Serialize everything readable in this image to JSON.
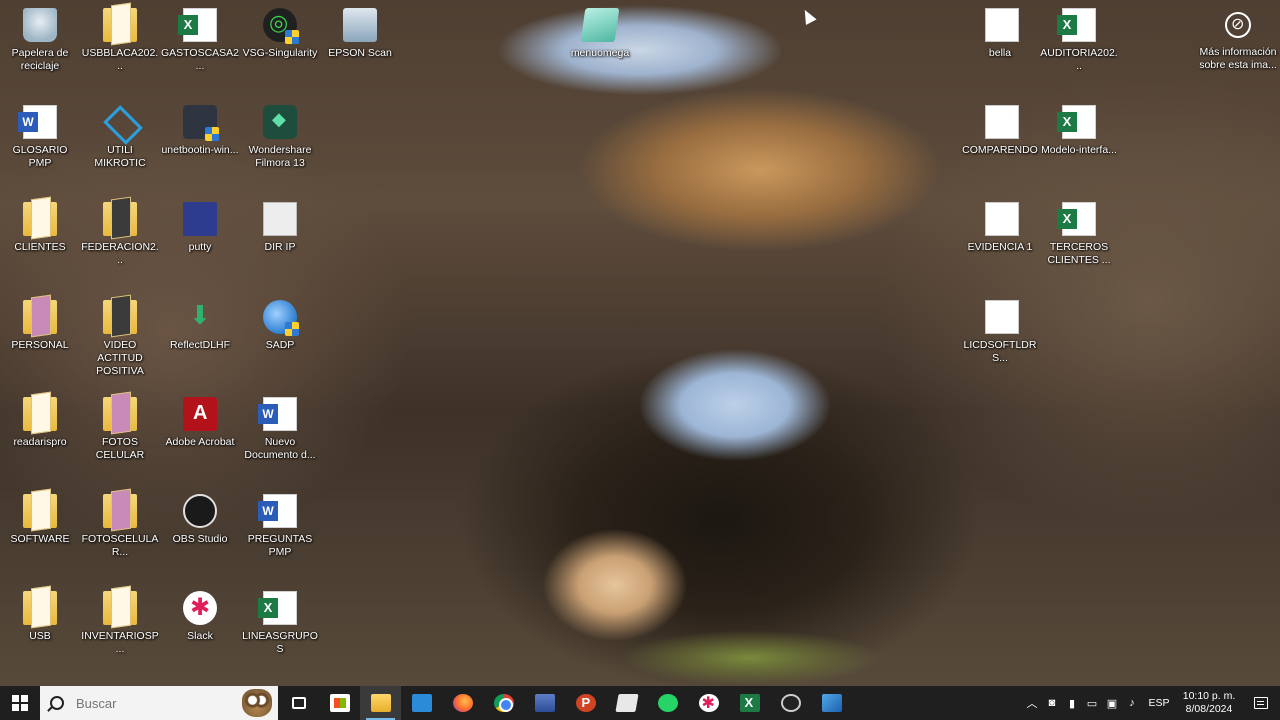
{
  "desktop": {
    "icons": [
      {
        "label": "Papelera de reciclaje",
        "icon": "recycle-bin-icon"
      },
      {
        "label": "USBBLACA202...",
        "icon": "folder-icon"
      },
      {
        "label": "GASTOSCASA2...",
        "icon": "excel-file-icon"
      },
      {
        "label": "VSG-Singularity",
        "icon": "vsg-singularity-icon"
      },
      {
        "label": "EPSON Scan",
        "icon": "epson-scan-icon"
      },
      {
        "label": "menuomega",
        "icon": "menuomega-icon"
      },
      {
        "label": "GLOSARIO PMP",
        "icon": "word-file-icon"
      },
      {
        "label": "UTILI MIKROTIC",
        "icon": "network-icon"
      },
      {
        "label": "unetbootin-win...",
        "icon": "unetbootin-icon"
      },
      {
        "label": "Wondershare Filmora 13",
        "icon": "filmora-icon"
      },
      {
        "label": "CLIENTES",
        "icon": "folder-icon"
      },
      {
        "label": "FEDERACION2...",
        "icon": "folder-icon"
      },
      {
        "label": "putty",
        "icon": "putty-icon"
      },
      {
        "label": "DIR IP",
        "icon": "text-file-icon"
      },
      {
        "label": "PERSONAL",
        "icon": "folder-icon"
      },
      {
        "label": "VIDEO ACTITUD POSITIVA",
        "icon": "folder-icon"
      },
      {
        "label": "ReflectDLHF",
        "icon": "download-icon"
      },
      {
        "label": "SADP",
        "icon": "sadp-icon"
      },
      {
        "label": "readarispro",
        "icon": "folder-icon"
      },
      {
        "label": "FOTOS CELULAR",
        "icon": "folder-icon"
      },
      {
        "label": "Adobe Acrobat",
        "icon": "adobe-acrobat-icon"
      },
      {
        "label": "Nuevo Documento d...",
        "icon": "word-file-icon"
      },
      {
        "label": "SOFTWARE",
        "icon": "folder-icon"
      },
      {
        "label": "FOTOSCELULAR...",
        "icon": "folder-icon"
      },
      {
        "label": "OBS Studio",
        "icon": "obs-studio-icon"
      },
      {
        "label": "PREGUNTAS PMP",
        "icon": "word-file-icon"
      },
      {
        "label": "USB",
        "icon": "folder-icon"
      },
      {
        "label": "INVENTARIOSP...",
        "icon": "folder-icon"
      },
      {
        "label": "Slack",
        "icon": "slack-icon"
      },
      {
        "label": "LINEASGRUPOS",
        "icon": "excel-file-icon"
      },
      {
        "label": "bella",
        "icon": "blank-file-icon"
      },
      {
        "label": "AUDITORIA202...",
        "icon": "excel-file-icon"
      },
      {
        "label": "COMPARENDO",
        "icon": "blank-file-icon"
      },
      {
        "label": "Modelo-interfa...",
        "icon": "excel-file-icon"
      },
      {
        "label": "EVIDENCIA 1",
        "icon": "blank-file-icon"
      },
      {
        "label": "TERCEROS CLIENTES ...",
        "icon": "excel-file-icon"
      },
      {
        "label": "LICDSOFTLDRS...",
        "icon": "blank-file-icon"
      }
    ],
    "info_widget": {
      "label": "Más información sobre esta ima..."
    }
  },
  "taskbar": {
    "search_placeholder": "Buscar",
    "pinned": [
      "task-view-icon",
      "microsoft-store-icon",
      "file-explorer-icon",
      "mail-icon",
      "firefox-icon",
      "chrome-icon",
      "network-tool-icon",
      "powerpoint-icon",
      "notes-icon",
      "whatsapp-icon",
      "slack-icon",
      "excel-icon",
      "vsg-icon",
      "paint-icon"
    ],
    "tray": {
      "language": "ESP",
      "time": "10:10 p. m.",
      "date": "8/08/2024"
    }
  }
}
